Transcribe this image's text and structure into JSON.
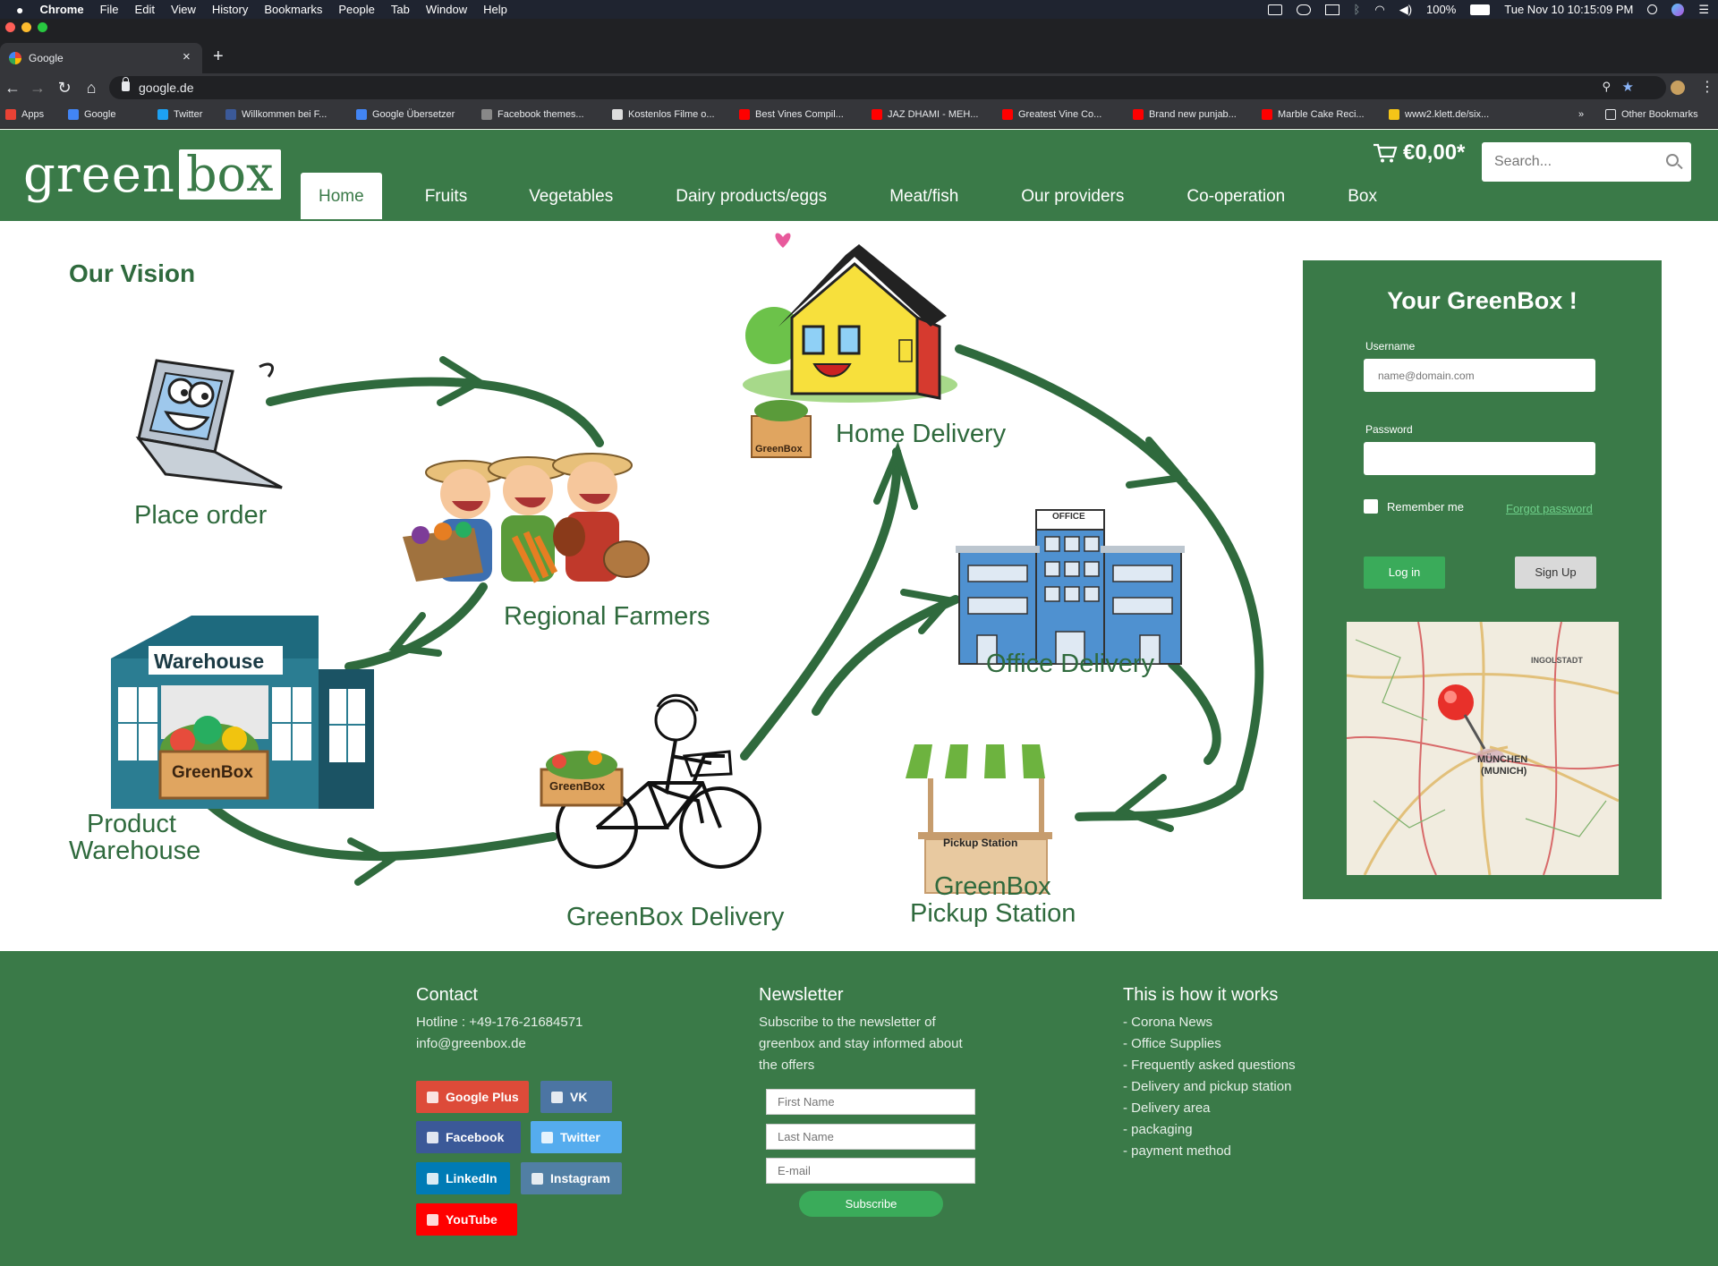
{
  "menubar": {
    "app": "Chrome",
    "items": [
      "File",
      "Edit",
      "View",
      "History",
      "Bookmarks",
      "People",
      "Tab",
      "Window",
      "Help"
    ],
    "battery": "100%",
    "clock": "Tue Nov 10  10:15:09 PM"
  },
  "browser": {
    "tab_title": "Google",
    "tab_close": "×",
    "new_tab": "+",
    "url": "google.de",
    "bookmarks": [
      {
        "label": "Apps",
        "color": "#e94235"
      },
      {
        "label": "Google",
        "color": "#4285f4"
      },
      {
        "label": "Twitter",
        "color": "#1da1f2"
      },
      {
        "label": "Willkommen bei F...",
        "color": "#3b5998"
      },
      {
        "label": "Google Übersetzer",
        "color": "#4285f4"
      },
      {
        "label": "Facebook themes...",
        "color": "#888888"
      },
      {
        "label": "Kostenlos Filme o...",
        "color": "#dddddd"
      },
      {
        "label": "Best Vines Compil...",
        "color": "#ff0000"
      },
      {
        "label": "JAZ DHAMI - MEH...",
        "color": "#ff0000"
      },
      {
        "label": "Greatest Vine Co...",
        "color": "#ff0000"
      },
      {
        "label": "Brand new punjab...",
        "color": "#ff0000"
      },
      {
        "label": "Marble Cake Reci...",
        "color": "#ff0000"
      },
      {
        "label": "www2.klett.de/six...",
        "color": "#f5c518"
      }
    ],
    "other_bookmarks": "Other Bookmarks"
  },
  "site": {
    "logo_green": "green",
    "logo_box": "box",
    "cart_total": "€0,00*",
    "search_placeholder": "Search...",
    "nav": [
      "Home",
      "Fruits",
      "Vegetables",
      "Dairy products/eggs",
      "Meat/fish",
      "Our providers",
      "Co-operation",
      "Box"
    ],
    "active_nav": "Home"
  },
  "vision": {
    "title": "Our Vision",
    "place_order": "Place order",
    "regional_farmers": "Regional Farmers",
    "product_warehouse_1": "Product",
    "product_warehouse_2": "Warehouse",
    "warehouse_sign": "Warehouse",
    "greenbox_crate": "GreenBox",
    "greenbox_delivery": "GreenBox Delivery",
    "home_delivery": "Home Delivery",
    "office_delivery": "Office Delivery",
    "office_sign": "OFFICE",
    "pickup_sign": "Pickup Station",
    "pickup_station_1": "GreenBox",
    "pickup_station_2": "Pickup Station"
  },
  "login": {
    "title": "Your GreenBox !",
    "username_label": "Username",
    "username_placeholder": "name@domain.com",
    "password_label": "Password",
    "remember_me": "Remember me",
    "forgot_password": "Forgot password",
    "login_button": "Log in",
    "signup_button": "Sign Up",
    "map_label_1": "MÜNCHEN",
    "map_label_2": "(MUNICH)",
    "map_label_3": "INGOLSTADT"
  },
  "footer": {
    "contact_title": "Contact",
    "hotline": "Hotline : +49-176-21684571",
    "email": "info@greenbox.de",
    "social": [
      {
        "label": "Google Plus",
        "color": "#dd4b39"
      },
      {
        "label": "VK",
        "color": "#4c75a3"
      },
      {
        "label": "Facebook",
        "color": "#3b5998"
      },
      {
        "label": "Twitter",
        "color": "#55acee"
      },
      {
        "label": "LinkedIn",
        "color": "#007bb5"
      },
      {
        "label": "Instagram",
        "color": "#517fa4"
      },
      {
        "label": "YouTube",
        "color": "#ff0000"
      }
    ],
    "newsletter_title": "Newsletter",
    "newsletter_text_1": "Subscribe to the newsletter of",
    "newsletter_text_2": "greenbox and stay informed about",
    "newsletter_text_3": "the offers",
    "first_name_placeholder": "First Name",
    "last_name_placeholder": "Last Name",
    "email_placeholder": "E-mail",
    "subscribe_button": "Subscribe",
    "how_title": "This is how it works",
    "how_items": [
      "- Corona News",
      "- Office Supplies",
      "- Frequently asked questions",
      "- Delivery and pickup station",
      "- Delivery area",
      "- packaging",
      "- payment method"
    ]
  },
  "colors": {
    "brand_green": "#3a7a48",
    "dark_green": "#2f6a3d",
    "button_green": "#3aab5a"
  }
}
